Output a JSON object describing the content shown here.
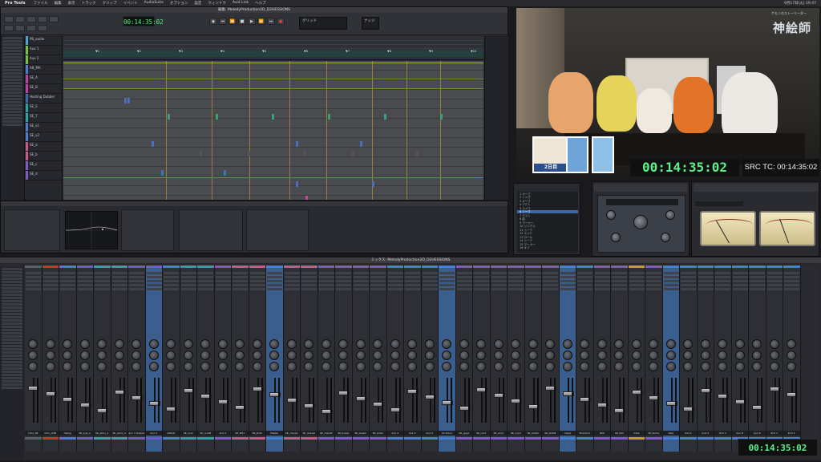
{
  "menubar": {
    "app": "Pro Tools",
    "items": [
      "ファイル",
      "編集",
      "表示",
      "トラック",
      "クリップ",
      "イベント",
      "AudioSuite",
      "オプション",
      "設定",
      "ウィンドウ",
      "Avid Link",
      "ヘルプ"
    ],
    "clock": "9月17日(火) 19:47"
  },
  "edit_window": {
    "counter": "00:14:35:02",
    "grid": "グリッド",
    "nudge": "ナッジ",
    "markers": [
      "1",
      "2",
      "3",
      "4",
      "5",
      "6",
      "7",
      "8",
      "9",
      "10"
    ],
    "track_names": [
      "PB_audio",
      "Aux 1",
      "Aux 2",
      "AB_MA",
      "SE_A",
      "SE_B",
      "Hosting Dubber",
      "SE_S",
      "SE_T",
      "SE_v1",
      "SE_v2",
      "SE_a",
      "SE_b",
      "SE_c",
      "SE_d"
    ]
  },
  "video": {
    "logo": "神絵師",
    "logo_sub": "ケモノのストーリーダー",
    "day": "2日目",
    "timecode": "00:14:35:02",
    "src_tc": "SRC TC: 00:14:35:02"
  },
  "memory_locations": {
    "items": [
      "1 オープ",
      "2 ニング",
      "3 オープ",
      "4 アクト",
      "5 カメラ",
      "6 トーク",
      "7 ゲスト",
      "8 曲",
      "9 マーカー",
      "10 ジングル",
      "11 トーク",
      "12 エンド",
      "13 ロール",
      "14 トーク",
      "15 マーカー",
      "16 オフ"
    ]
  },
  "mix": {
    "title": "ミックス: MelodyProduction2D_D2HESSIONS",
    "timecode": "00:14:35:02",
    "strip_names": [
      "Intro_SE",
      "Intro_A3B",
      "dialog",
      "SE_pup_1",
      "SE_atmo_1",
      "SE_atmo_2",
      "Aux 1 Output",
      "Aux 2",
      "AllPost",
      "SE_rock",
      "SE_rockB",
      "Aux 3",
      "SE_MST",
      "SE_Ruth",
      "Master",
      "SE_chara1",
      "SE_chara2",
      "SE_chara3",
      "SE_bossa",
      "SE_dream",
      "SE_smile",
      "Aux 4",
      "Aux 5",
      "Aux 6",
      "Int Solve",
      "SE_goya",
      "SE_vox1",
      "SE_vox2",
      "SE_vox3",
      "SE_AmbA",
      "SE_AmbB",
      "clipsA",
      "Phantom",
      "PAN",
      "SE_Mid",
      "rides",
      "SE_Kume",
      "strip",
      "Ond 1",
      "Ond 2",
      "Ond 3",
      "Aux D",
      "Aux 8",
      "End 1",
      "End 2"
    ],
    "strip_colors": [
      "#5a5f6a",
      "#c0392b",
      "#4a7fd0",
      "#6c5fc7",
      "#3aa0a0",
      "#3aa0a0",
      "#6c5fc7",
      "#6c5fc7",
      "#4a7fd0",
      "#2aa3a3",
      "#2aa3a3",
      "#7e5cc4",
      "#c65b8a",
      "#c65b8a",
      "#4a7fd0",
      "#c65b8a",
      "#c65b8a",
      "#7e5cc4",
      "#7e5cc4",
      "#7e5cc4",
      "#7e5cc4",
      "#4a7fd0",
      "#4a7fd0",
      "#4a7fd0",
      "#4a7fd0",
      "#7e5cc4",
      "#7e5cc4",
      "#7e5cc4",
      "#7e5cc4",
      "#7e5cc4",
      "#7e5cc4",
      "#4a7fd0",
      "#4a7fd0",
      "#7e5cc4",
      "#7e5cc4",
      "#c0a030",
      "#7e5cc4",
      "#4a7fd0",
      "#4a7fd0",
      "#4a7fd0",
      "#4a7fd0",
      "#4a7fd0",
      "#4a7fd0",
      "#4a7fd0",
      "#4a7fd0"
    ]
  }
}
